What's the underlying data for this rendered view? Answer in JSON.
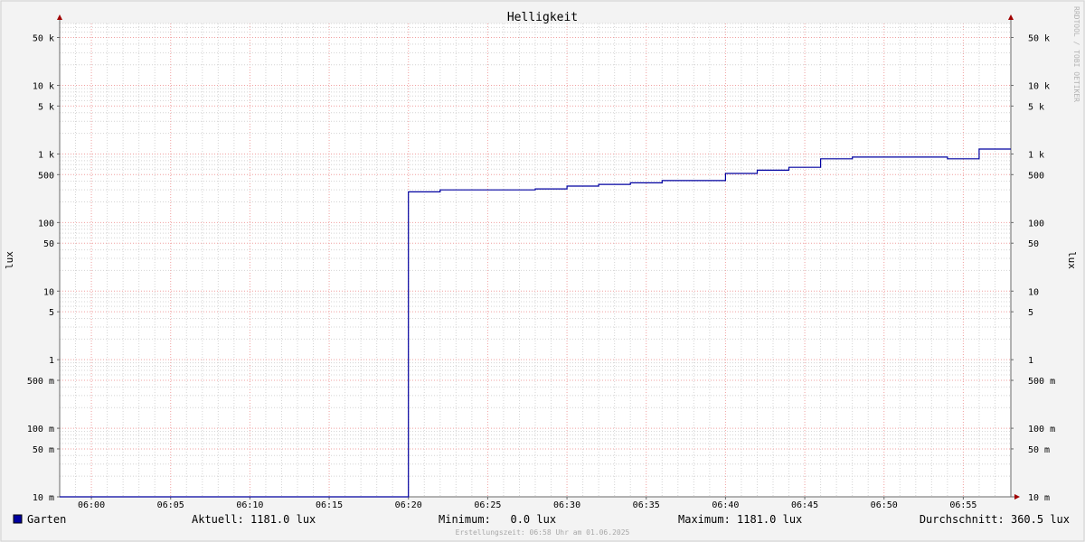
{
  "colors": {
    "series": "#0000a0",
    "arrow": "#a00000"
  },
  "watermark": "RRDTOOL / TOBI OETIKER",
  "footer": "Erstellungszeit: 06:58 Uhr am 01.06.2025",
  "legend": {
    "series_name": "Garten",
    "aktuell": "Aktuell: 1181.0 lux",
    "minimum": "Minimum:   0.0 lux",
    "maximum": "Maximum: 1181.0 lux",
    "durchschnitt": "Durchschnitt: 360.5 lux"
  },
  "chart_data": {
    "type": "line",
    "title": "Helligkeit",
    "xlabel": "",
    "ylabel": "lux",
    "ylabel_right": "lux",
    "yscale": "log",
    "xlim": [
      "05:58",
      "06:58"
    ],
    "ylim": [
      0.01,
      80000
    ],
    "grid": true,
    "x_ticks": [
      "06:00",
      "06:05",
      "06:10",
      "06:15",
      "06:20",
      "06:25",
      "06:30",
      "06:35",
      "06:40",
      "06:45",
      "06:50",
      "06:55"
    ],
    "y_ticks": [
      {
        "value": 0.01,
        "label": "10 m"
      },
      {
        "value": 0.05,
        "label": "50 m"
      },
      {
        "value": 0.1,
        "label": "100 m"
      },
      {
        "value": 0.5,
        "label": "500 m"
      },
      {
        "value": 1,
        "label": "1"
      },
      {
        "value": 5,
        "label": "5"
      },
      {
        "value": 10,
        "label": "10"
      },
      {
        "value": 50,
        "label": "50"
      },
      {
        "value": 100,
        "label": "100"
      },
      {
        "value": 500,
        "label": "500"
      },
      {
        "value": 1000,
        "label": "1 k"
      },
      {
        "value": 5000,
        "label": "5 k"
      },
      {
        "value": 10000,
        "label": "10 k"
      },
      {
        "value": 50000,
        "label": "50 k"
      }
    ],
    "series": [
      {
        "name": "Garten",
        "step": true,
        "points": [
          {
            "x": "05:58",
            "y": 0.01
          },
          {
            "x": "06:20",
            "y": 0.01
          },
          {
            "x": "06:20",
            "y": 280
          },
          {
            "x": "06:22",
            "y": 300
          },
          {
            "x": "06:28",
            "y": 310
          },
          {
            "x": "06:30",
            "y": 340
          },
          {
            "x": "06:32",
            "y": 360
          },
          {
            "x": "06:34",
            "y": 380
          },
          {
            "x": "06:36",
            "y": 410
          },
          {
            "x": "06:40",
            "y": 520
          },
          {
            "x": "06:42",
            "y": 580
          },
          {
            "x": "06:44",
            "y": 640
          },
          {
            "x": "06:46",
            "y": 850
          },
          {
            "x": "06:48",
            "y": 900
          },
          {
            "x": "06:54",
            "y": 850
          },
          {
            "x": "06:56",
            "y": 1181
          },
          {
            "x": "06:58",
            "y": 1181
          }
        ]
      }
    ]
  }
}
